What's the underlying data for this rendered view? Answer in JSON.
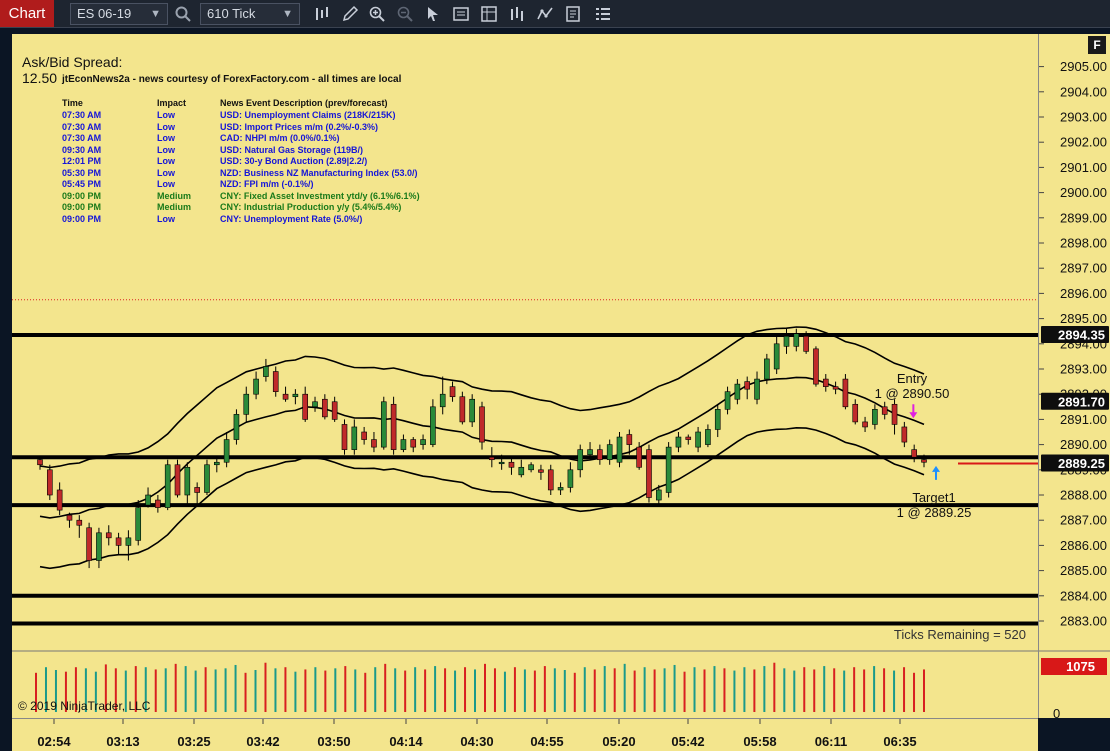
{
  "toolbar": {
    "tab_label": "Chart",
    "instrument": "ES 06-19",
    "interval": "610 Tick"
  },
  "chart_panel": {
    "f_button": "F",
    "ask_bid_label": "Ask/Bid Spread:",
    "spread_value": "12.50",
    "news_title": "jtEconNews2a - news courtesy of ForexFactory.com - all times are local",
    "news_headers": {
      "time": "Time",
      "impact": "Impact",
      "desc": "News Event Description (prev/forecast)"
    },
    "news": [
      {
        "time": "07:30 AM",
        "impact": "Low",
        "desc": "USD: Unemployment Claims (218K/215K)",
        "color": "#1515d8"
      },
      {
        "time": "07:30 AM",
        "impact": "Low",
        "desc": "USD: Import Prices m/m (0.2%/-0.3%)",
        "color": "#1515d8"
      },
      {
        "time": "07:30 AM",
        "impact": "Low",
        "desc": "CAD: NHPI m/m (0.0%/0.1%)",
        "color": "#1515d8"
      },
      {
        "time": "09:30 AM",
        "impact": "Low",
        "desc": "USD: Natural Gas Storage (119B/)",
        "color": "#1515d8"
      },
      {
        "time": "12:01 PM",
        "impact": "Low",
        "desc": "USD: 30-y Bond Auction (2.89|2.2/)",
        "color": "#1515d8"
      },
      {
        "time": "05:30 PM",
        "impact": "Low",
        "desc": "NZD: Business NZ Manufacturing Index (53.0/)",
        "color": "#1515d8"
      },
      {
        "time": "05:45 PM",
        "impact": "Low",
        "desc": "NZD: FPI m/m (-0.1%/)",
        "color": "#1515d8"
      },
      {
        "time": "09:00 PM",
        "impact": "Medium",
        "desc": "CNY: Fixed Asset Investment ytd/y (6.1%/6.1%)",
        "color": "#1a7a1a"
      },
      {
        "time": "09:00 PM",
        "impact": "Medium",
        "desc": "CNY: Industrial Production y/y (5.4%/5.4%)",
        "color": "#1a7a1a"
      },
      {
        "time": "09:00 PM",
        "impact": "Low",
        "desc": "CNY: Unemployment Rate (5.0%/)",
        "color": "#1515d8"
      }
    ],
    "entry_label": "Entry",
    "entry_order": "1 @ 2890.50",
    "target_label": "Target1",
    "target_order": "1 @ 2889.25",
    "ticks_remaining": "Ticks Remaining = 520",
    "copyright": "© 2019 NinjaTrader, LLC"
  },
  "chart_data": {
    "type": "candlestick",
    "price_axis": {
      "ylim": [
        2882.2,
        2905.6
      ],
      "ticks": [
        "2883.00",
        "2884.00",
        "2885.00",
        "2886.00",
        "2887.00",
        "2888.00",
        "2889.00",
        "2890.00",
        "2891.00",
        "2892.00",
        "2893.00",
        "2894.00",
        "2895.00",
        "2896.00",
        "2897.00",
        "2898.00",
        "2899.00",
        "2900.00",
        "2901.00",
        "2902.00",
        "2903.00",
        "2904.00",
        "2905.00"
      ],
      "markers": [
        {
          "label": "2894.35",
          "value": 2894.35
        },
        {
          "label": "2891.70",
          "value": 2891.7
        },
        {
          "label": "2889.25",
          "value": 2889.25
        }
      ]
    },
    "x_ticks": [
      "02:54",
      "03:13",
      "03:25",
      "03:42",
      "03:50",
      "04:14",
      "04:30",
      "04:55",
      "05:20",
      "05:42",
      "05:58",
      "06:11",
      "06:35"
    ],
    "horizontal_lines": [
      2894.35,
      2889.5,
      2887.6,
      2884.0,
      2882.9
    ],
    "dotted_line": 2895.75,
    "target_line": 2889.25,
    "candles": [
      [
        2889.4,
        2889.2,
        2889.5,
        2889.0
      ],
      [
        2889.0,
        2888.0,
        2889.2,
        2887.8
      ],
      [
        2888.2,
        2887.4,
        2888.5,
        2887.2
      ],
      [
        2887.2,
        2887.0,
        2887.3,
        2886.7
      ],
      [
        2887.0,
        2886.8,
        2887.2,
        2886.3
      ],
      [
        2886.7,
        2885.4,
        2886.9,
        2885.1
      ],
      [
        2885.4,
        2886.5,
        2886.7,
        2885.1
      ],
      [
        2886.5,
        2886.3,
        2886.8,
        2886.0
      ],
      [
        2886.3,
        2886.0,
        2886.5,
        2885.6
      ],
      [
        2886.0,
        2886.3,
        2886.6,
        2885.4
      ],
      [
        2886.2,
        2887.5,
        2887.8,
        2886.0
      ],
      [
        2887.6,
        2888.0,
        2888.3,
        2887.5
      ],
      [
        2887.8,
        2887.5,
        2888.0,
        2887.3
      ],
      [
        2887.5,
        2889.2,
        2889.4,
        2887.4
      ],
      [
        2889.2,
        2888.0,
        2889.4,
        2887.9
      ],
      [
        2888.0,
        2889.1,
        2889.3,
        2887.6
      ],
      [
        2888.3,
        2888.1,
        2888.5,
        2887.6
      ],
      [
        2888.1,
        2889.2,
        2889.4,
        2888.0
      ],
      [
        2889.2,
        2889.3,
        2889.5,
        2888.9
      ],
      [
        2889.3,
        2890.2,
        2890.5,
        2889.1
      ],
      [
        2890.2,
        2891.2,
        2891.4,
        2890.0
      ],
      [
        2891.2,
        2892.0,
        2892.3,
        2890.9
      ],
      [
        2892.0,
        2892.6,
        2892.9,
        2891.8
      ],
      [
        2892.7,
        2893.1,
        2893.4,
        2892.5
      ],
      [
        2892.9,
        2892.1,
        2893.1,
        2891.9
      ],
      [
        2892.0,
        2891.8,
        2892.3,
        2891.7
      ],
      [
        2891.9,
        2892.0,
        2892.2,
        2891.6
      ],
      [
        2892.0,
        2891.0,
        2892.3,
        2890.9
      ],
      [
        2891.5,
        2891.7,
        2891.9,
        2891.3
      ],
      [
        2891.8,
        2891.1,
        2892.0,
        2891.0
      ],
      [
        2891.7,
        2891.0,
        2891.9,
        2890.9
      ],
      [
        2890.8,
        2889.8,
        2891.0,
        2889.6
      ],
      [
        2889.8,
        2890.7,
        2891.0,
        2889.6
      ],
      [
        2890.5,
        2890.2,
        2890.7,
        2890.0
      ],
      [
        2890.2,
        2889.9,
        2890.5,
        2889.7
      ],
      [
        2889.9,
        2891.7,
        2891.9,
        2889.8
      ],
      [
        2891.6,
        2889.8,
        2891.9,
        2889.6
      ],
      [
        2889.8,
        2890.2,
        2890.4,
        2889.7
      ],
      [
        2890.2,
        2889.9,
        2890.3,
        2889.7
      ],
      [
        2890.0,
        2890.2,
        2890.4,
        2889.8
      ],
      [
        2890.0,
        2891.5,
        2891.8,
        2889.9
      ],
      [
        2891.5,
        2892.0,
        2892.7,
        2891.2
      ],
      [
        2892.3,
        2891.9,
        2892.5,
        2891.7
      ],
      [
        2891.9,
        2890.9,
        2892.1,
        2890.8
      ],
      [
        2890.9,
        2891.8,
        2892.0,
        2890.7
      ],
      [
        2891.5,
        2890.1,
        2891.7,
        2889.8
      ],
      [
        2889.5,
        2889.4,
        2889.9,
        2889.1
      ],
      [
        2889.3,
        2889.3,
        2889.6,
        2889.0
      ],
      [
        2889.3,
        2889.1,
        2889.5,
        2888.8
      ],
      [
        2888.8,
        2889.1,
        2889.4,
        2888.7
      ],
      [
        2889.0,
        2889.2,
        2889.3,
        2888.9
      ],
      [
        2889.0,
        2888.9,
        2889.2,
        2888.6
      ],
      [
        2889.0,
        2888.2,
        2889.2,
        2888.0
      ],
      [
        2888.2,
        2888.3,
        2888.5,
        2888.0
      ],
      [
        2888.3,
        2889.0,
        2889.3,
        2888.1
      ],
      [
        2889.0,
        2889.8,
        2890.0,
        2888.7
      ],
      [
        2889.6,
        2889.8,
        2890.1,
        2889.4
      ],
      [
        2889.8,
        2889.4,
        2890.0,
        2889.2
      ],
      [
        2889.4,
        2890.0,
        2890.2,
        2889.2
      ],
      [
        2889.3,
        2890.3,
        2890.5,
        2889.1
      ],
      [
        2890.4,
        2890.0,
        2890.6,
        2889.6
      ],
      [
        2889.9,
        2889.1,
        2890.1,
        2889.0
      ],
      [
        2889.8,
        2887.9,
        2890.0,
        2887.7
      ],
      [
        2887.8,
        2888.2,
        2888.4,
        2887.6
      ],
      [
        2888.1,
        2889.9,
        2890.1,
        2887.9
      ],
      [
        2889.9,
        2890.3,
        2890.5,
        2889.7
      ],
      [
        2890.3,
        2890.2,
        2890.4,
        2890.0
      ],
      [
        2889.9,
        2890.5,
        2890.7,
        2889.7
      ],
      [
        2890.0,
        2890.6,
        2890.8,
        2889.9
      ],
      [
        2890.6,
        2891.4,
        2891.6,
        2890.3
      ],
      [
        2891.4,
        2892.1,
        2892.3,
        2891.2
      ],
      [
        2891.8,
        2892.4,
        2892.6,
        2891.6
      ],
      [
        2892.5,
        2892.2,
        2892.7,
        2891.8
      ],
      [
        2891.8,
        2892.6,
        2892.9,
        2891.6
      ],
      [
        2892.6,
        2893.4,
        2893.6,
        2892.4
      ],
      [
        2893.0,
        2894.0,
        2894.3,
        2892.8
      ],
      [
        2893.9,
        2894.3,
        2894.6,
        2893.6
      ],
      [
        2893.9,
        2894.4,
        2894.6,
        2893.7
      ],
      [
        2894.3,
        2893.7,
        2894.5,
        2893.6
      ],
      [
        2893.8,
        2892.4,
        2893.9,
        2892.3
      ],
      [
        2892.6,
        2892.3,
        2892.8,
        2892.1
      ],
      [
        2892.3,
        2892.2,
        2892.5,
        2892.0
      ],
      [
        2892.6,
        2891.5,
        2892.8,
        2891.4
      ],
      [
        2891.6,
        2890.9,
        2891.8,
        2890.8
      ],
      [
        2890.9,
        2890.7,
        2891.1,
        2890.5
      ],
      [
        2890.8,
        2891.4,
        2891.6,
        2890.6
      ],
      [
        2891.5,
        2891.2,
        2891.7,
        2891.0
      ],
      [
        2891.6,
        2890.8,
        2891.8,
        2890.4
      ],
      [
        2890.7,
        2890.1,
        2890.9,
        2889.9
      ],
      [
        2889.8,
        2889.5,
        2890.0,
        2889.3
      ],
      [
        2889.4,
        2889.3,
        2889.6,
        2889.1
      ]
    ],
    "volume": {
      "axis_labels": {
        "top": "1075",
        "bottom": "0"
      },
      "bars": [
        [
          "#d82020",
          0.7
        ],
        [
          "#1a9a8a",
          0.8
        ],
        [
          "#1a9a8a",
          0.75
        ],
        [
          "#d82020",
          0.72
        ],
        [
          "#d82020",
          0.8
        ],
        [
          "#1a9a8a",
          0.78
        ],
        [
          "#1a9a8a",
          0.72
        ],
        [
          "#d82020",
          0.85
        ],
        [
          "#d82020",
          0.78
        ],
        [
          "#1a9a8a",
          0.74
        ],
        [
          "#d82020",
          0.82
        ],
        [
          "#1a9a8a",
          0.8
        ],
        [
          "#d82020",
          0.76
        ],
        [
          "#1a9a8a",
          0.78
        ],
        [
          "#d82020",
          0.86
        ],
        [
          "#1a9a8a",
          0.82
        ],
        [
          "#1a9a8a",
          0.74
        ],
        [
          "#d82020",
          0.8
        ],
        [
          "#1a9a8a",
          0.76
        ],
        [
          "#1a9a8a",
          0.78
        ],
        [
          "#1a9a8a",
          0.84
        ],
        [
          "#d82020",
          0.7
        ],
        [
          "#1a9a8a",
          0.75
        ],
        [
          "#d82020",
          0.88
        ],
        [
          "#1a9a8a",
          0.78
        ],
        [
          "#d82020",
          0.8
        ],
        [
          "#1a9a8a",
          0.72
        ],
        [
          "#d82020",
          0.76
        ],
        [
          "#1a9a8a",
          0.8
        ],
        [
          "#d82020",
          0.74
        ],
        [
          "#1a9a8a",
          0.78
        ],
        [
          "#d82020",
          0.82
        ],
        [
          "#1a9a8a",
          0.76
        ],
        [
          "#d82020",
          0.7
        ],
        [
          "#1a9a8a",
          0.8
        ],
        [
          "#d82020",
          0.86
        ],
        [
          "#1a9a8a",
          0.78
        ],
        [
          "#d82020",
          0.74
        ],
        [
          "#1a9a8a",
          0.8
        ],
        [
          "#d82020",
          0.76
        ],
        [
          "#1a9a8a",
          0.82
        ],
        [
          "#d82020",
          0.78
        ],
        [
          "#1a9a8a",
          0.74
        ],
        [
          "#d82020",
          0.8
        ],
        [
          "#1a9a8a",
          0.76
        ],
        [
          "#d82020",
          0.86
        ],
        [
          "#d82020",
          0.78
        ],
        [
          "#1a9a8a",
          0.72
        ],
        [
          "#d82020",
          0.8
        ],
        [
          "#1a9a8a",
          0.76
        ],
        [
          "#d82020",
          0.74
        ],
        [
          "#d82020",
          0.82
        ],
        [
          "#1a9a8a",
          0.78
        ],
        [
          "#1a9a8a",
          0.75
        ],
        [
          "#d82020",
          0.7
        ],
        [
          "#1a9a8a",
          0.8
        ],
        [
          "#d82020",
          0.76
        ],
        [
          "#1a9a8a",
          0.82
        ],
        [
          "#d82020",
          0.78
        ],
        [
          "#1a9a8a",
          0.86
        ],
        [
          "#d82020",
          0.74
        ],
        [
          "#1a9a8a",
          0.8
        ],
        [
          "#d82020",
          0.76
        ],
        [
          "#1a9a8a",
          0.78
        ],
        [
          "#1a9a8a",
          0.84
        ],
        [
          "#d82020",
          0.72
        ],
        [
          "#1a9a8a",
          0.8
        ],
        [
          "#d82020",
          0.76
        ],
        [
          "#1a9a8a",
          0.82
        ],
        [
          "#d82020",
          0.78
        ],
        [
          "#1a9a8a",
          0.74
        ],
        [
          "#1a9a8a",
          0.8
        ],
        [
          "#d82020",
          0.76
        ],
        [
          "#1a9a8a",
          0.82
        ],
        [
          "#d82020",
          0.88
        ],
        [
          "#1a9a8a",
          0.78
        ],
        [
          "#1a9a8a",
          0.74
        ],
        [
          "#d82020",
          0.8
        ],
        [
          "#d82020",
          0.76
        ],
        [
          "#1a9a8a",
          0.82
        ],
        [
          "#d82020",
          0.78
        ],
        [
          "#1a9a8a",
          0.74
        ],
        [
          "#d82020",
          0.8
        ],
        [
          "#d82020",
          0.76
        ],
        [
          "#1a9a8a",
          0.82
        ],
        [
          "#d82020",
          0.78
        ],
        [
          "#1a9a8a",
          0.74
        ],
        [
          "#d82020",
          0.8
        ],
        [
          "#d82020",
          0.7
        ],
        [
          "#d82020",
          0.76
        ]
      ]
    },
    "colors": {
      "up": "#2a8a3a",
      "down": "#c02a2a",
      "background": "#f3e58d",
      "level_line": "#000000",
      "target_line": "#d81818",
      "stop_line": "#d81818"
    }
  }
}
